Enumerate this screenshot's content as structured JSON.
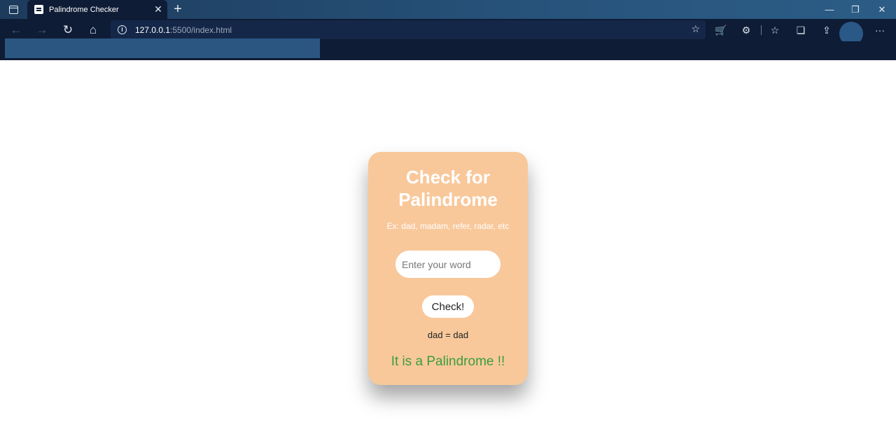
{
  "browser": {
    "tab_title": "Palindrome Checker",
    "tab_close": "✕",
    "new_tab": "+",
    "url_host": "127.0.0.1",
    "url_path": ":5500/index.html",
    "minimize": "—",
    "restore": "❐",
    "close": "✕",
    "more": "···"
  },
  "card": {
    "title": "Check for Palindrome",
    "hint": "Ex: dad, madam, refer, radar, etc",
    "input_placeholder": "Enter your word",
    "input_value": "",
    "button_label": "Check!",
    "comparison": "dad = dad",
    "result": "It is a Palindrome !!"
  },
  "colors": {
    "card_background": "#f8c89b",
    "result_text": "#3a9e3a",
    "toolbar": "#0f1c36"
  }
}
